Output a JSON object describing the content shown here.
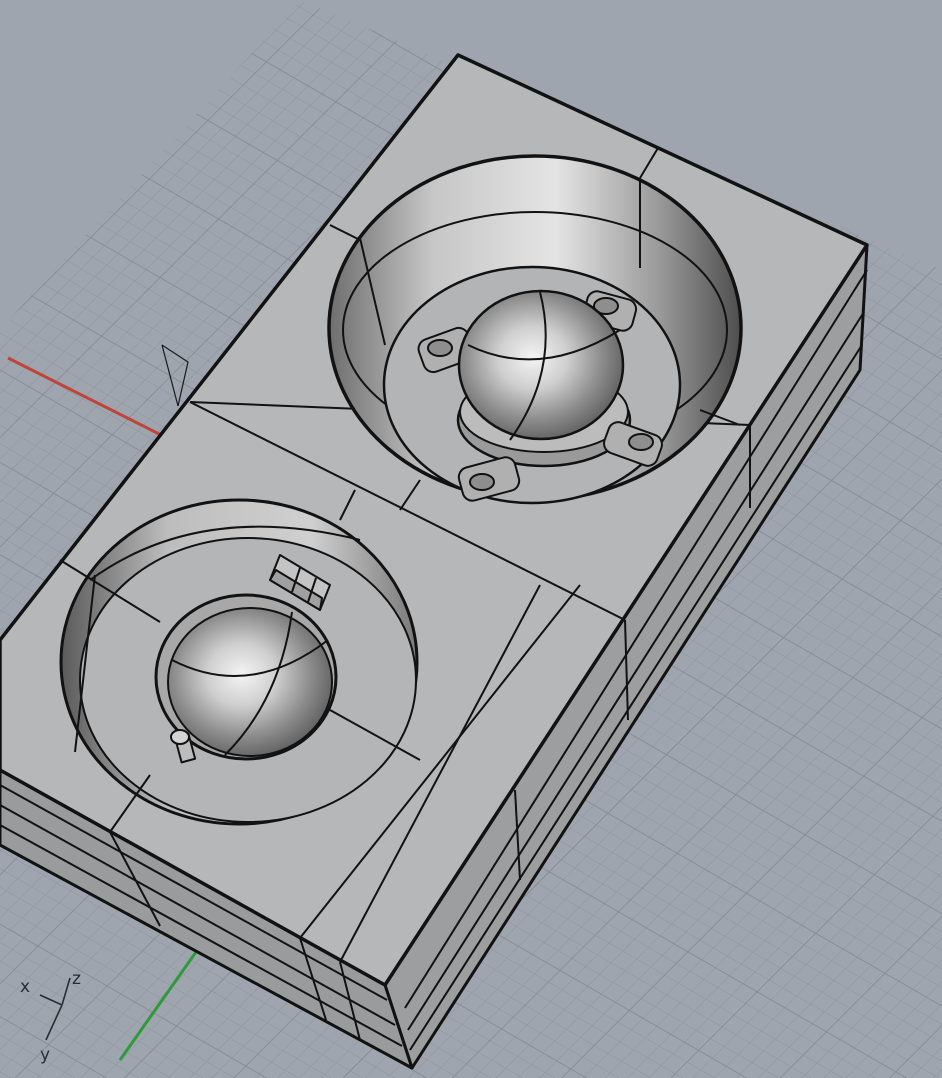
{
  "viewport": {
    "background": "#9ea5ae",
    "grid_color": "#8a9199",
    "x_axis_color": "#c0443a",
    "y_axis_color": "#2e9a3a",
    "model_fill": "#b7b9bb",
    "model_edge": "#121212"
  },
  "gizmo": {
    "x_label": "x",
    "y_label": "y",
    "z_label": "z"
  }
}
